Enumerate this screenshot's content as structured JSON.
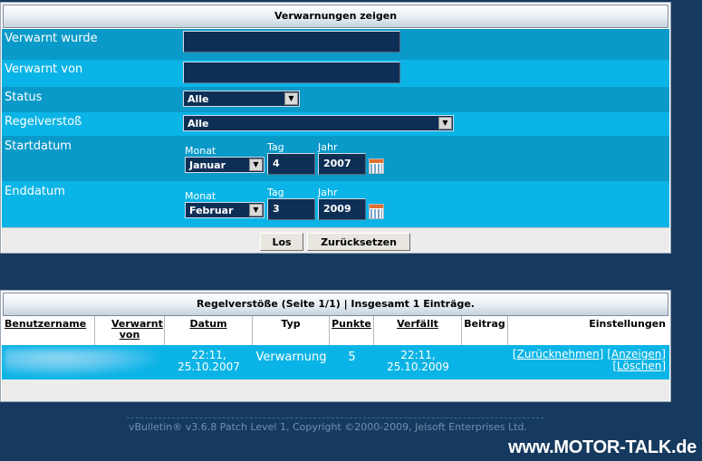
{
  "filter": {
    "title": "Verwarnungen zeigen",
    "warned_user_label": "Verwarnt wurde",
    "warned_user_value": "",
    "warned_by_label": "Verwarnt von",
    "warned_by_value": "",
    "status_label": "Status",
    "status_value": "Alle",
    "violation_label": "Regelverstoß",
    "violation_value": "Alle",
    "start_label": "Startdatum",
    "end_label": "Enddatum",
    "month_label": "Monat",
    "day_label": "Tag",
    "year_label": "Jahr",
    "start_month": "Januar",
    "start_day": "4",
    "start_year": "2007",
    "end_month": "Februar",
    "end_day": "3",
    "end_year": "2009",
    "go_button": "Los",
    "reset_button": "Zurücksetzen"
  },
  "results": {
    "title": "Regelverstöße (Seite 1/1) | Insgesamt 1 Einträge.",
    "columns": {
      "username": "Benutzername",
      "warned_by": "Verwarnt von",
      "date": "Datum",
      "type": "Typ",
      "points": "Punkte",
      "expires": "Verfällt",
      "post": "Beitrag",
      "settings": "Einstellungen"
    },
    "rows": [
      {
        "date_time": "22:11,",
        "date_day": "25.10.2007",
        "type": "Verwarnung",
        "points": "5",
        "expires_time": "22:11,",
        "expires_day": "25.10.2009",
        "post": "",
        "revoke": "[Zurücknehmen]",
        "view": "[Anzeigen]",
        "delete": "[Löschen]"
      }
    ]
  },
  "footer": {
    "copyright": "vBulletin® v3.6.8 Patch Level 1, Copyright ©2000-2009, Jelsoft Enterprises Ltd.",
    "watermark": "www.MOTOR-TALK.de"
  },
  "colors": {
    "page_bg": "#163a5f",
    "row_dark": "#0a9ac9",
    "row_light": "#0bb4e6",
    "input_bg": "#0e2f55"
  },
  "icons": [
    "calendar-icon",
    "chevron-down-icon"
  ]
}
